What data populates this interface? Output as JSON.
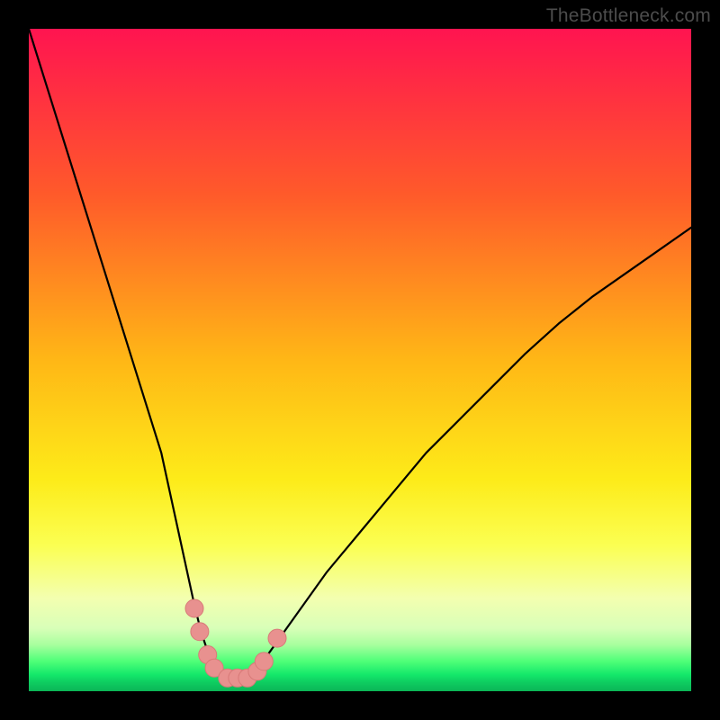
{
  "watermark": "TheBottleneck.com",
  "chart_data": {
    "type": "line",
    "title": "",
    "xlabel": "",
    "ylabel": "",
    "xlim": [
      0,
      100
    ],
    "ylim": [
      0,
      100
    ],
    "grid": false,
    "series": [
      {
        "name": "bottleneck-curve",
        "x": [
          0,
          5,
          10,
          15,
          20,
          25,
          26,
          27,
          28,
          29,
          30,
          31,
          32,
          33,
          34,
          35,
          40,
          45,
          50,
          55,
          60,
          65,
          70,
          75,
          80,
          85,
          90,
          95,
          100
        ],
        "y": [
          100,
          84,
          68,
          52,
          36,
          13,
          9,
          6,
          4,
          2.5,
          2,
          2,
          2,
          2,
          2.5,
          4,
          11,
          18,
          24,
          30,
          36,
          41,
          46,
          51,
          55.5,
          59.5,
          63,
          66.5,
          70
        ]
      }
    ],
    "markers": [
      {
        "name": "marker-left-1",
        "x": 25.0,
        "y": 12.5
      },
      {
        "name": "marker-left-2",
        "x": 25.8,
        "y": 9.0
      },
      {
        "name": "marker-left-3",
        "x": 27.0,
        "y": 5.5
      },
      {
        "name": "marker-left-4",
        "x": 28.0,
        "y": 3.5
      },
      {
        "name": "marker-bottom-1",
        "x": 30.0,
        "y": 2.0
      },
      {
        "name": "marker-bottom-2",
        "x": 31.5,
        "y": 2.0
      },
      {
        "name": "marker-bottom-3",
        "x": 33.0,
        "y": 2.0
      },
      {
        "name": "marker-right-1",
        "x": 34.5,
        "y": 3.0
      },
      {
        "name": "marker-right-2",
        "x": 35.5,
        "y": 4.5
      },
      {
        "name": "marker-right-3",
        "x": 37.5,
        "y": 8.0
      }
    ],
    "colors": {
      "marker_fill": "#e8918f",
      "marker_stroke": "#d87a78",
      "curve": "#000000",
      "gradient_stops": [
        {
          "offset": 0.0,
          "color": "#ff1450"
        },
        {
          "offset": 0.25,
          "color": "#ff5a2a"
        },
        {
          "offset": 0.5,
          "color": "#ffb716"
        },
        {
          "offset": 0.68,
          "color": "#fdeb19"
        },
        {
          "offset": 0.78,
          "color": "#fbff52"
        },
        {
          "offset": 0.86,
          "color": "#f3ffb0"
        },
        {
          "offset": 0.905,
          "color": "#d8ffb8"
        },
        {
          "offset": 0.93,
          "color": "#a8ff9e"
        },
        {
          "offset": 0.955,
          "color": "#4eff78"
        },
        {
          "offset": 0.975,
          "color": "#14e86a"
        },
        {
          "offset": 0.985,
          "color": "#0fd062"
        },
        {
          "offset": 1.0,
          "color": "#0bb556"
        }
      ]
    }
  }
}
